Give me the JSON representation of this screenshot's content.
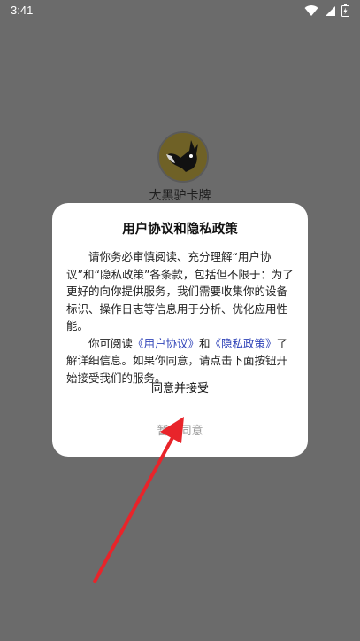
{
  "status_bar": {
    "time": "3:41"
  },
  "splash": {
    "app_name": "大黑驴卡牌"
  },
  "dialog": {
    "title": "用户协议和隐私政策",
    "p1": "请你务必审慎阅读、充分理解“用户协议”和“隐私政策”各条款，包括但不限于：为了更好的向你提供服务，我们需要收集你的设备标识、操作日志等信息用于分析、优化应用性能。",
    "p2_prefix": "你可阅读",
    "user_agreement_link": "《用户协议》",
    "p2_and": "和",
    "privacy_policy_link": "《隐私政策》",
    "p2_suffix": "了解详细信息。如果你同意，请点击下面按钮开始接受我们的服务。",
    "accept_label": "同意并接受",
    "decline_label": "暂不同意"
  },
  "colors": {
    "overlay": "#6b6b6b",
    "link": "#2f43b8",
    "arrow": "#e8242a"
  }
}
